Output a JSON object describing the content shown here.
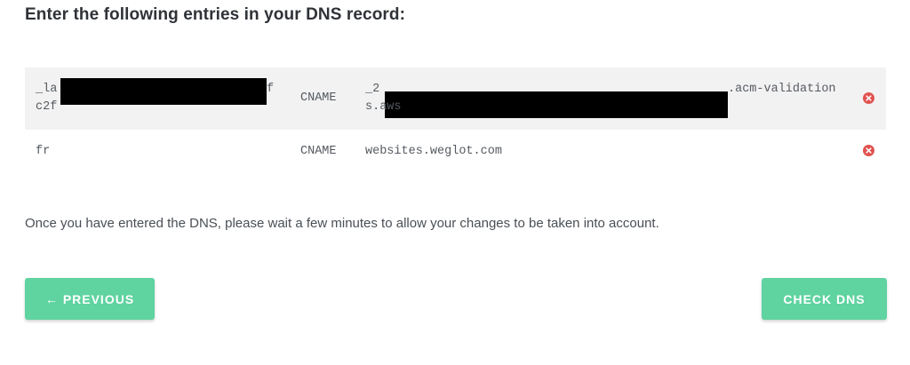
{
  "heading": "Enter the following entries in your DNS record:",
  "records": [
    {
      "host_visible_start": "_la",
      "host_visible_end": "f",
      "host_line2": "c2f",
      "type": "CNAME",
      "value_visible_start": "_2",
      "value_visible_end": ".acm-validation",
      "value_line2": "s.aws",
      "redacted": true
    },
    {
      "host": "fr",
      "type": "CNAME",
      "value": "websites.weglot.com",
      "redacted": false
    }
  ],
  "delete_icon": "close-circle-icon",
  "colors": {
    "accent": "#5fd3a0",
    "delete": "#e0524f",
    "row_alt": "#f2f2f2"
  },
  "info_text": "Once you have entered the DNS, please wait a few minutes to allow your changes to be taken into account.",
  "buttons": {
    "previous_arrow": "←",
    "previous_label": "PREVIOUS",
    "check_label": "CHECK DNS"
  }
}
